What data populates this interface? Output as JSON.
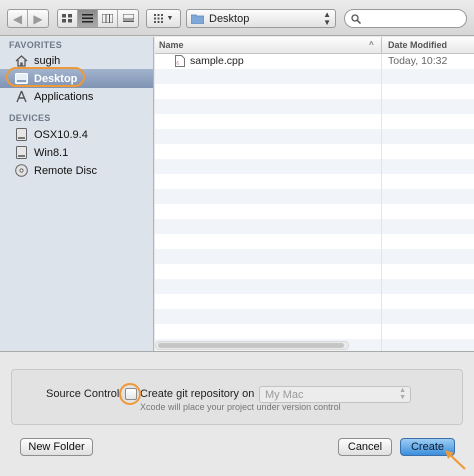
{
  "toolbar": {
    "back_glyph": "◀",
    "forward_glyph": "▶",
    "location": "Desktop",
    "search_placeholder": ""
  },
  "sidebar": {
    "favorites_header": "FAVORITES",
    "favorites": [
      {
        "label": "sugih",
        "icon": "home-icon"
      },
      {
        "label": "Desktop",
        "icon": "desktop-icon",
        "selected": true
      },
      {
        "label": "Applications",
        "icon": "applications-icon"
      }
    ],
    "devices_header": "DEVICES",
    "devices": [
      {
        "label": "OSX10.9.4",
        "icon": "drive-icon"
      },
      {
        "label": "Win8.1",
        "icon": "drive-icon"
      },
      {
        "label": "Remote Disc",
        "icon": "disc-icon"
      }
    ]
  },
  "filelist": {
    "columns": {
      "name": "Name",
      "sort_indicator": "^",
      "date": "Date Modified"
    },
    "files": [
      {
        "name": "sample.cpp",
        "date": "Today, 10:32",
        "icon": "cpp-file-icon"
      }
    ]
  },
  "options": {
    "source_control_label": "Source Control:",
    "checkbox_label": "Create git repository on",
    "checkbox_checked": false,
    "target_select": "My Mac",
    "note": "Xcode will place your project under version control"
  },
  "buttons": {
    "new_folder": "New Folder",
    "cancel": "Cancel",
    "create": "Create"
  },
  "colors": {
    "highlight_ring": "#ef9a3a",
    "selection": "#7f93b3",
    "default_button": "#3c8fdc"
  }
}
